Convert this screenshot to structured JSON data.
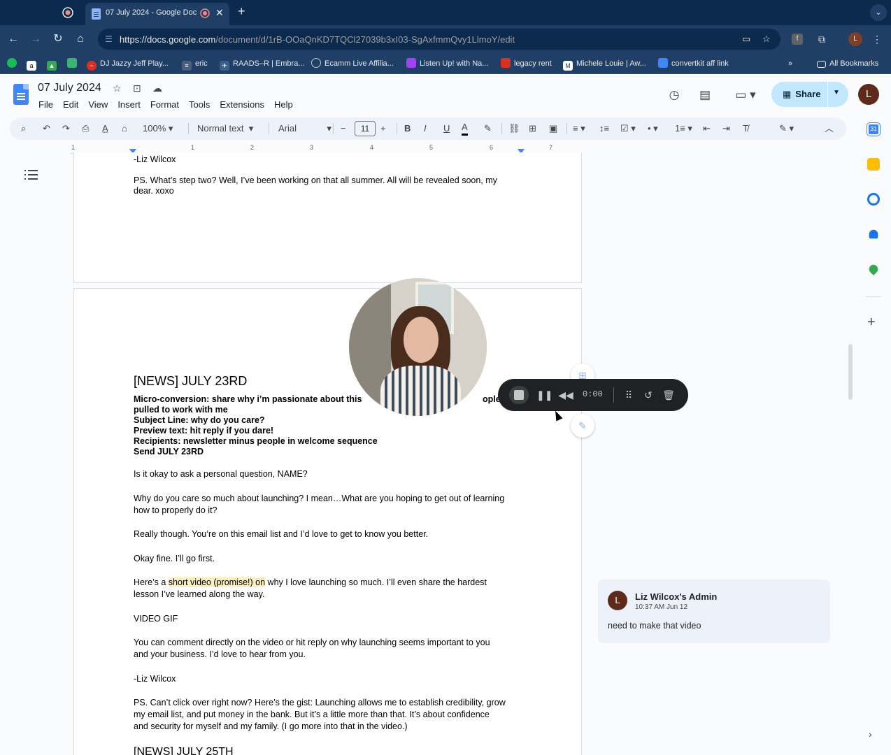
{
  "browser": {
    "tab_title": "07 July 2024 - Google Docs",
    "url_host": "https://docs.google.com",
    "url_path": "/document/d/1rB-OOaQnKD7TQCl27039b3xI03-SgAxfmmQvy1LlmoY/edit",
    "profile_initial": "L",
    "bookmarks": [
      "DJ Jazzy Jeff Play...",
      "eric",
      "RAADS–R | Embra...",
      "Ecamm Live Affilia...",
      "Listen Up! with Na...",
      "legacy rent",
      "Michele Louie | Aw...",
      "convertkit aff link"
    ],
    "all_bookmarks": "All Bookmarks"
  },
  "docs": {
    "title": "07 July 2024",
    "menu": [
      "File",
      "Edit",
      "View",
      "Insert",
      "Format",
      "Tools",
      "Extensions",
      "Help"
    ],
    "share_label": "Share",
    "user_initial": "L"
  },
  "toolbar": {
    "zoom": "100%",
    "style": "Normal text",
    "font": "Arial",
    "font_size": "11"
  },
  "ruler": [
    "1",
    "1",
    "2",
    "3",
    "4",
    "5",
    "6",
    "7"
  ],
  "document": {
    "page1": {
      "signoff": "-Liz Wilcox",
      "ps_line1": "PS. What’s step two? Well, I’ve been working on that all summer. All will be revealed soon, my",
      "ps_line2": "dear. xoxo"
    },
    "page2": {
      "heading": "[NEWS] JULY 23RD",
      "meta": [
        "Micro-conversion: share why i’m passionate about this",
        "pulled to work with me",
        "Subject Line: why do you care?",
        "Preview text: hit reply if you dare!",
        "Recipients: newsletter minus people in welcome sequence",
        "Send JULY 23RD"
      ],
      "meta_fragment": "ople feel",
      "p1": "Is it okay to ask a personal question, NAME?",
      "p2a": "Why do you care so much about launching? I mean…What are you hoping to get out of learning",
      "p2b": "how to properly do it?",
      "p3": "Really though. You’re on this email list and I’d love to get to know you better.",
      "p4": "Okay fine. I’ll go first.",
      "p5_pre": "Here’s a ",
      "p5_hl": "short video (promise!) on",
      "p5_post": " why I love launching so much. I’ll even share the hardest",
      "p5b": "lesson I’ve learned along the way.",
      "p6": "VIDEO GIF",
      "p7a": "You can comment directly on the video or hit reply on why launching seems important to you",
      "p7b": "and your business. I’d love to hear from you.",
      "p8": "-Liz Wilcox",
      "p9a": "PS. Can’t click over right now? Here’s the gist: Launching allows me to establish credibility, grow",
      "p9b": "my email list, and put money in the bank. But it’s a little more than that. It’s about confidence",
      "p9c": "and security for myself and my family. (I go more into that in the video.)",
      "next_heading": "[NEWS] JULY 25TH"
    }
  },
  "recorder": {
    "time": "0:00"
  },
  "comment": {
    "initial": "L",
    "author": "Liz Wilcox's Admin",
    "time": "10:37 AM Jun 12",
    "text": "need to make that video"
  },
  "colors": {
    "chrome_dark": "#0b2a4d",
    "chrome_mid": "#1f3f66",
    "share_bg": "#c2e7ff",
    "highlight": "#fbefc1",
    "accent_blue": "#4285f4"
  }
}
